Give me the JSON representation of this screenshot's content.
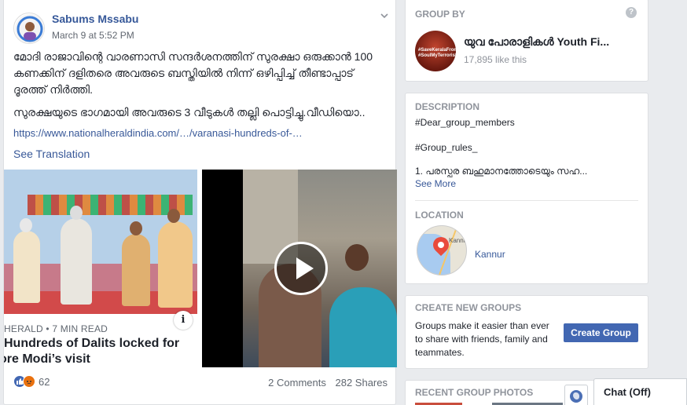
{
  "post": {
    "author": "Sabums Mssabu",
    "timestamp": "March 9 at 5:52 PM",
    "paragraph1": "മോദി രാജാവിന്റെ വാരണാസി സന്ദർശനത്തിന് സുരക്ഷാ ഒരുക്കാൻ 100 കണക്കിന് ദളിതരെ അവരുടെ ബസ്തിയിൽ നിന്ന് ഒഴിപ്പിച്ച് തീണ്ടാപ്പാട് ദൂരത്ത് നിർത്തി.",
    "paragraph2": "സുരക്ഷയുടെ ഭാഗമായി അവരുടെ 3 വീടുകൾ തല്ലി പൊട്ടിച്ചു.വീഡിയൊ..",
    "link": "https://www.nationalheraldindia.com/…/varanasi-hundreds-of-…",
    "see_translation": "See Translation",
    "article": {
      "source": "HERALD • 7 MIN READ",
      "headline_line1": "Hundreds of Dalits locked for",
      "headline_line2": "ore Modi’s visit"
    },
    "info_icon": "i",
    "reaction_count": "62",
    "comments": "2 Comments",
    "shares": "282 Shares"
  },
  "group_by": {
    "title": "GROUP BY",
    "help_icon": "?",
    "page_name": "യുവ പോരാളികൾ Youth Fi...",
    "likes": "17,895 like this",
    "avatar_text": "#SaveKeralaFrom #SoulMyTerrorists"
  },
  "about": {
    "description_title": "DESCRIPTION",
    "desc_line1": "#Dear_group_members",
    "desc_line2": "#Group_rules_",
    "desc_line3": "1. പരസ്പര ബഹുമാനത്തോടെയും സഹ...",
    "see_more": "See More",
    "location_title": "LOCATION",
    "location_name": "Kannur",
    "map_label": "Kannu"
  },
  "create_groups": {
    "title": "CREATE NEW GROUPS",
    "description": "Groups make it easier than ever to share with friends, family and teammates.",
    "button": "Create Group"
  },
  "recent_photos": {
    "title": "RECENT GROUP PHOTOS"
  },
  "chat": {
    "label": "Chat (Off)"
  },
  "colors": {
    "link": "#365899",
    "button": "#4267b2",
    "background": "#e9ebee"
  },
  "icons": [
    "chevron-down-icon",
    "info-icon",
    "play-icon",
    "like-icon",
    "angry-icon",
    "help-icon",
    "map-pin-icon",
    "globe-icon"
  ]
}
